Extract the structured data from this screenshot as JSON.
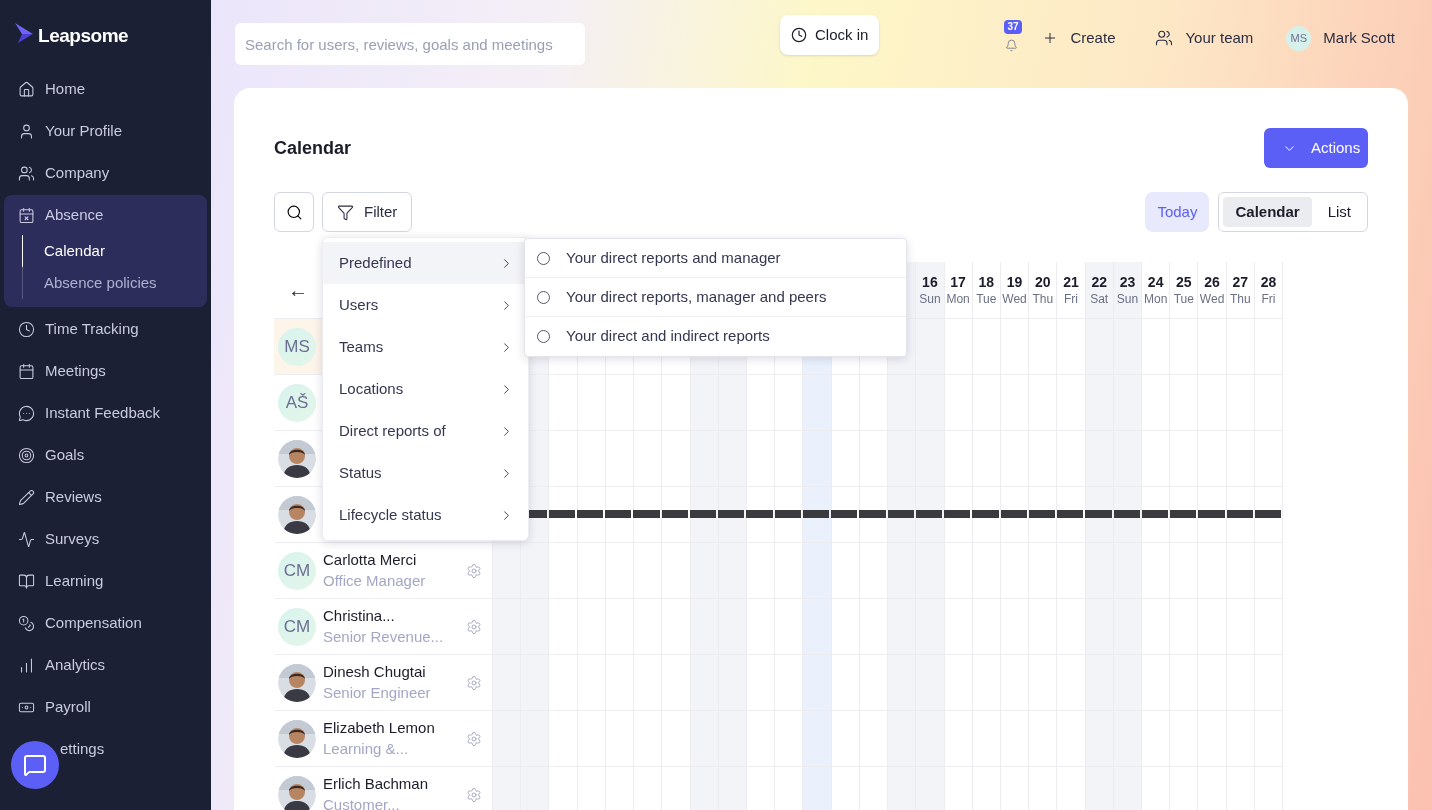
{
  "sidebar": {
    "logo": "Leapsome",
    "items": [
      {
        "label": "Home",
        "selected": false
      },
      {
        "label": "Your Profile",
        "selected": false
      },
      {
        "label": "Company",
        "selected": false
      },
      {
        "label": "Absence",
        "selected": true,
        "expanded": true,
        "children": [
          {
            "label": "Calendar",
            "selected": true
          },
          {
            "label": "Absence policies",
            "selected": false
          }
        ]
      },
      {
        "label": "Time Tracking",
        "selected": false
      },
      {
        "label": "Meetings",
        "selected": false
      },
      {
        "label": "Instant Feedback",
        "selected": false
      },
      {
        "label": "Goals",
        "selected": false
      },
      {
        "label": "Reviews",
        "selected": false
      },
      {
        "label": "Surveys",
        "selected": false
      },
      {
        "label": "Learning",
        "selected": false
      },
      {
        "label": "Compensation",
        "selected": false
      },
      {
        "label": "Analytics",
        "selected": false
      },
      {
        "label": "Payroll",
        "selected": false
      },
      {
        "label": "ettings",
        "selected": false
      }
    ]
  },
  "topbar": {
    "search": {
      "placeholder": "Search for users, reviews, goals and meetings"
    },
    "clock_in": "Clock in",
    "notifications": "37",
    "create": "Create",
    "your_team": "Your team",
    "user": {
      "initials": "MS",
      "name": "Mark Scott"
    }
  },
  "page": {
    "title": "Calendar",
    "actions": "Actions",
    "filter": "Filter",
    "today": "Today",
    "views": [
      {
        "label": "Calendar",
        "selected": true
      },
      {
        "label": "List",
        "selected": false
      }
    ]
  },
  "filter_menu": {
    "items": [
      {
        "label": "Predefined",
        "selected": true
      },
      {
        "label": "Users",
        "selected": false
      },
      {
        "label": "Teams",
        "selected": false
      },
      {
        "label": "Locations",
        "selected": false
      },
      {
        "label": "Direct reports of",
        "selected": false
      },
      {
        "label": "Status",
        "selected": false
      },
      {
        "label": "Lifecycle status",
        "selected": false
      }
    ],
    "submenu": [
      {
        "label": "Your direct reports and manager",
        "checked": false
      },
      {
        "label": "Your direct reports, manager and peers",
        "checked": false
      },
      {
        "label": "Your direct and indirect reports",
        "checked": false
      }
    ]
  },
  "calendar": {
    "back": "←",
    "columns": [
      {
        "weekend": true,
        "today": false
      },
      {
        "weekend": true,
        "today": false
      },
      {
        "weekend": false,
        "today": false
      },
      {
        "weekend": false,
        "today": false
      },
      {
        "weekend": false,
        "today": false
      },
      {
        "weekend": false,
        "today": false
      },
      {
        "weekend": false,
        "today": false
      },
      {
        "weekend": true,
        "today": false
      },
      {
        "weekend": true,
        "today": false
      },
      {
        "weekend": false,
        "today": false
      },
      {
        "weekend": false,
        "today": false
      },
      {
        "weekend": false,
        "today": true
      },
      {
        "weekend": false,
        "today": false
      },
      {
        "weekend": false,
        "today": false
      },
      {
        "weekend": true,
        "today": false
      },
      {
        "day": "16",
        "weekday": "Sun",
        "weekend": true,
        "today": false
      },
      {
        "day": "17",
        "weekday": "Mon",
        "weekend": false,
        "today": false
      },
      {
        "day": "18",
        "weekday": "Tue",
        "weekend": false,
        "today": false
      },
      {
        "day": "19",
        "weekday": "Wed",
        "weekend": false,
        "today": false
      },
      {
        "day": "20",
        "weekday": "Thu",
        "weekend": false,
        "today": false
      },
      {
        "day": "21",
        "weekday": "Fri",
        "weekend": false,
        "today": false
      },
      {
        "day": "22",
        "weekday": "Sat",
        "weekend": true,
        "today": false
      },
      {
        "day": "23",
        "weekday": "Sun",
        "weekend": true,
        "today": false
      },
      {
        "day": "24",
        "weekday": "Mon",
        "weekend": false,
        "today": false
      },
      {
        "day": "25",
        "weekday": "Tue",
        "weekend": false,
        "today": false
      },
      {
        "day": "26",
        "weekday": "Wed",
        "weekend": false,
        "today": false
      },
      {
        "day": "27",
        "weekday": "Thu",
        "weekend": false,
        "today": false
      },
      {
        "day": "28",
        "weekday": "Fri",
        "weekend": false,
        "today": false
      }
    ],
    "rows": [
      {
        "avatar": {
          "kind": "initials",
          "initials": "MS"
        },
        "current_user": true
      },
      {
        "avatar": {
          "kind": "initials",
          "initials": "AŠ"
        },
        "current_user": false
      },
      {
        "current_user": false
      },
      {
        "current_user": false,
        "absence": true
      },
      {
        "avatar": {
          "kind": "initials",
          "initials": "CM"
        },
        "name": "Carlotta Merci",
        "role": "Office Manager",
        "current_user": false
      },
      {
        "avatar": {
          "kind": "initials",
          "initials": "CM"
        },
        "name": "Christina...",
        "role": "Senior Revenue...",
        "current_user": false
      },
      {
        "name": "Dinesh Chugtai",
        "role": "Senior Engineer",
        "current_user": false
      },
      {
        "name": "Elizabeth Lemon",
        "role": "Learning &...",
        "current_user": false
      },
      {
        "name": "Erlich Bachman",
        "role": "Customer...",
        "current_user": false
      }
    ]
  }
}
